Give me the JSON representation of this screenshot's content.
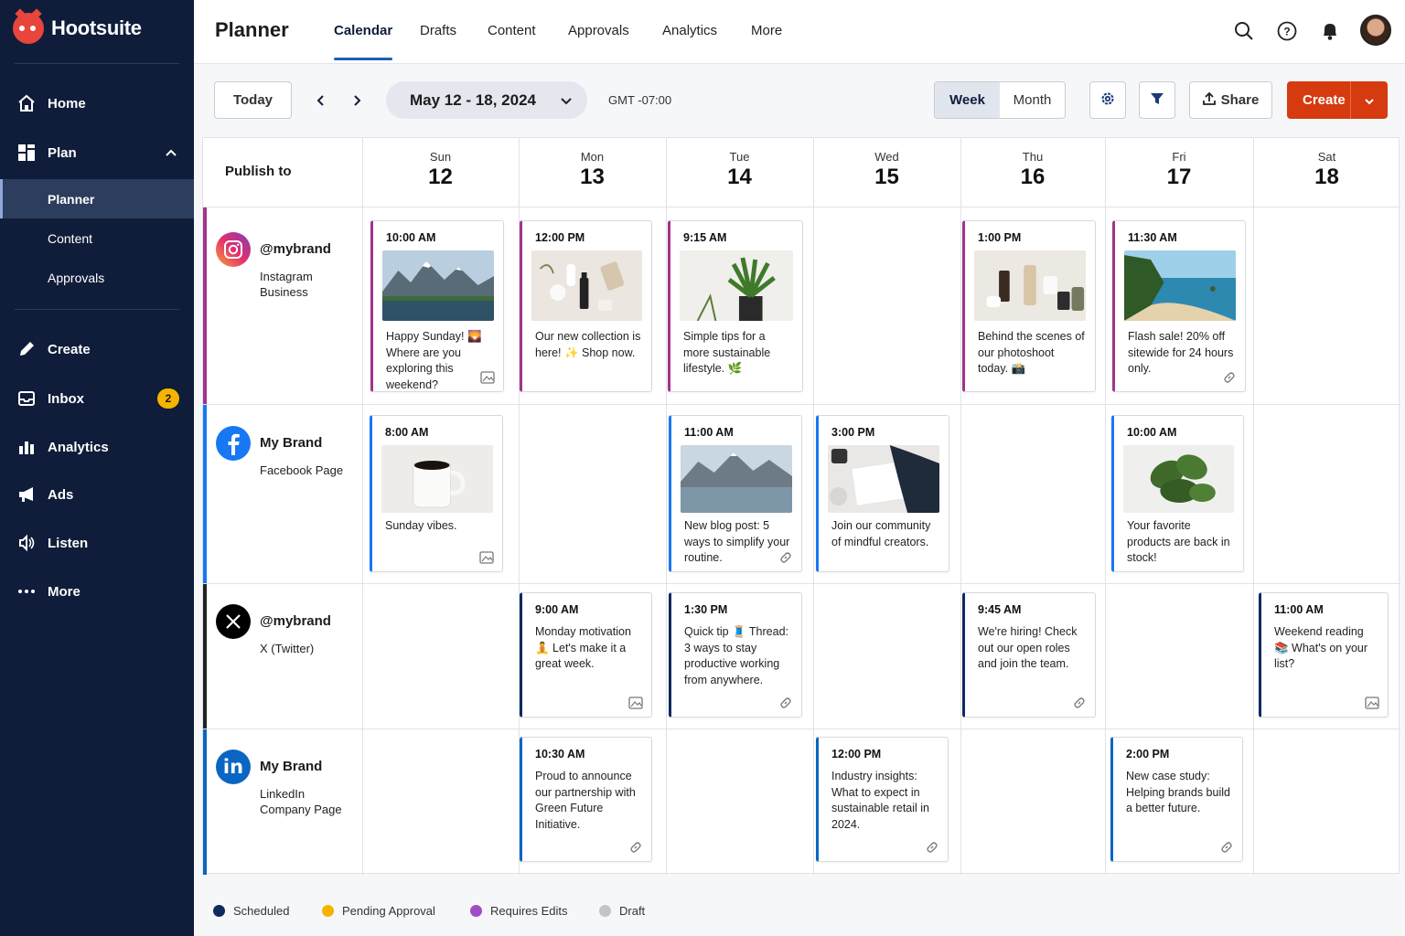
{
  "app": {
    "name": "Hootsuite"
  },
  "sidebar": {
    "items": [
      {
        "label": "Home",
        "icon": "home-icon"
      },
      {
        "label": "Plan",
        "icon": "plan-icon"
      },
      {
        "label": "Create",
        "icon": "pencil-icon"
      },
      {
        "label": "Inbox",
        "icon": "inbox-icon",
        "badge": "2"
      },
      {
        "label": "Analytics",
        "icon": "bar-chart-icon"
      },
      {
        "label": "Ads",
        "icon": "megaphone-icon"
      },
      {
        "label": "Listen",
        "icon": "listen-icon"
      },
      {
        "label": "More",
        "icon": "more-dots-icon"
      }
    ],
    "sub_items": [
      {
        "label": "Planner"
      },
      {
        "label": "Content"
      },
      {
        "label": "Approvals"
      }
    ]
  },
  "header": {
    "title": "Planner",
    "tabs": [
      {
        "label": "Calendar"
      },
      {
        "label": "Drafts"
      },
      {
        "label": "Content"
      },
      {
        "label": "Approvals"
      },
      {
        "label": "Analytics"
      },
      {
        "label": "More"
      }
    ]
  },
  "toolbar": {
    "today": "Today",
    "date_range": "May 12 - 18, 2024",
    "timezone": "GMT -07:00",
    "week": "Week",
    "month": "Month",
    "share": "Share",
    "create": "Create"
  },
  "calendar": {
    "publish_to": "Publish to",
    "days": [
      {
        "name": "Sun",
        "date": "12"
      },
      {
        "name": "Mon",
        "date": "13"
      },
      {
        "name": "Tue",
        "date": "14"
      },
      {
        "name": "Wed",
        "date": "15"
      },
      {
        "name": "Thu",
        "date": "16"
      },
      {
        "name": "Fri",
        "date": "17"
      },
      {
        "name": "Sat",
        "date": "18"
      }
    ],
    "accounts": [
      {
        "name": "@mybrand",
        "type": "Instagram Business",
        "network": "instagram",
        "color": "#a2338b"
      },
      {
        "name": "My Brand",
        "type": "Facebook Page",
        "network": "facebook",
        "color": "#1877f2"
      },
      {
        "name": "@mybrand",
        "type": "X (Twitter)",
        "network": "x",
        "color": "#222222"
      },
      {
        "name": "My Brand",
        "type": "LinkedIn Company Page",
        "network": "linkedin",
        "color": "#0a66c2"
      }
    ],
    "posts": [
      {
        "time": "10:00 AM",
        "text": "Happy Sunday! 🌄 Where are you exploring this weekend?",
        "image": "mountain-lake",
        "footer_icon": "image-icon",
        "status": "Requires Edits"
      },
      {
        "time": "12:00 PM",
        "text": "Our new collection is here! ✨ Shop now.",
        "image": "products",
        "status": "Requires Edits"
      },
      {
        "time": "9:15 AM",
        "text": "Simple tips for a more sustainable lifestyle. 🌿",
        "image": "plant",
        "status": "Requires Edits"
      },
      {
        "time": "1:00 PM",
        "text": "Behind the scenes of our photoshoot today. 📸",
        "image": "bottles",
        "status": "Requires Edits"
      },
      {
        "time": "11:30 AM",
        "text": "Flash sale! 20% off sitewide for 24 hours only.",
        "image": "beach",
        "footer_icon": "link-icon",
        "status": "Requires Edits"
      },
      {
        "time": "8:00 AM",
        "text": "Sunday vibes.",
        "image": "coffee",
        "footer_icon": "image-icon",
        "status": "Scheduled"
      },
      {
        "time": "11:00 AM",
        "text": "New blog post: 5 ways to simplify your routine.",
        "image": "mountain-lake-2",
        "footer_icon": "link-icon",
        "status": "Scheduled"
      },
      {
        "time": "3:00 PM",
        "text": "Join our community of mindful creators.",
        "image": "writing",
        "status": "Scheduled"
      },
      {
        "time": "10:00 AM",
        "text": "Your favorite products are back in stock!",
        "image": "monstera",
        "status": "Scheduled"
      },
      {
        "time": "9:00 AM",
        "text": "Monday motivation 🧘 Let's make it a great week.",
        "footer_icon": "image-icon",
        "status": "Scheduled"
      },
      {
        "time": "1:30 PM",
        "text": "Quick tip 🧵 Thread: 3 ways to stay productive working from anywhere.",
        "footer_icon": "link-icon",
        "status": "Scheduled"
      },
      {
        "time": "9:45 AM",
        "text": "We're hiring! Check out our open roles and join the team.",
        "footer_icon": "link-icon",
        "status": "Scheduled"
      },
      {
        "time": "11:00 AM",
        "text": "Weekend reading 📚 What's on your list?",
        "footer_icon": "image-icon",
        "status": "Scheduled"
      },
      {
        "time": "10:30 AM",
        "text": "Proud to announce our partnership with Green Future Initiative.",
        "footer_icon": "link-icon",
        "status": "Scheduled"
      },
      {
        "time": "12:00 PM",
        "text": "Industry insights: What to expect in sustainable retail in 2024.",
        "footer_icon": "link-icon",
        "status": "Scheduled"
      },
      {
        "time": "2:00 PM",
        "text": "New case study: Helping brands build a better future.",
        "footer_icon": "link-icon",
        "status": "Scheduled"
      }
    ]
  },
  "legend": [
    {
      "label": "Scheduled",
      "color": "#0f2a5c"
    },
    {
      "label": "Pending Approval",
      "color": "#f5b400"
    },
    {
      "label": "Requires Edits",
      "color": "#a04cc4"
    },
    {
      "label": "Draft",
      "color": "#c4c4c4"
    }
  ]
}
